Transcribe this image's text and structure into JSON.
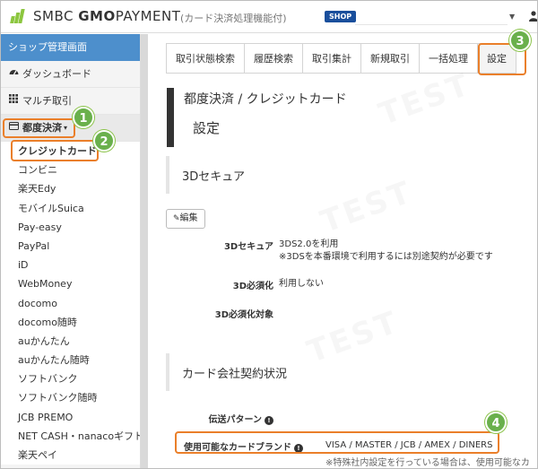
{
  "header": {
    "brand_prefix": "SMBC",
    "brand_bold": "GMO",
    "brand_suffix": "PAYMENT",
    "subtitle": "(カード決済処理機能付)",
    "shop_badge": "SHOP",
    "shop_value": "",
    "icons": {
      "user": "user-icon",
      "caret": "chevron-down-icon"
    }
  },
  "sidebar": {
    "heading": "ショップ管理画面",
    "items": [
      {
        "label": "ダッシュボード",
        "icon": "dashboard-icon"
      },
      {
        "label": "マルチ取引",
        "icon": "grid-icon"
      },
      {
        "label": "都度決済",
        "icon": "card-icon",
        "caret": "▾"
      }
    ],
    "sub_items": [
      "クレジットカード",
      "コンビニ",
      "楽天Edy",
      "モバイルSuica",
      "Pay-easy",
      "PayPal",
      "iD",
      "WebMoney",
      "docomo",
      "docomo随時",
      "auかんたん",
      "auかんたん随時",
      "ソフトバンク",
      "ソフトバンク随時",
      "JCB PREMO",
      "NET CASH・nanacoギフト",
      "楽天ペイ"
    ]
  },
  "tabs": [
    "取引状態検索",
    "履歴検索",
    "取引集計",
    "新規取引",
    "一括処理",
    "設定"
  ],
  "main": {
    "breadcrumb": "都度決済 / クレジットカード",
    "page_title": "設定",
    "secure_section": {
      "title": "3Dセキュア",
      "edit_label": "編集",
      "rows": [
        {
          "label": "3Dセキュア",
          "value": "3DS2.0を利用",
          "note": "※3DSを本番環境で利用するには別途契約が必要です"
        },
        {
          "label": "3D必須化",
          "value": "利用しない"
        },
        {
          "label": "3D必須化対象",
          "value": ""
        }
      ]
    },
    "contract_section": {
      "title": "カード会社契約状況",
      "rows": [
        {
          "label": "伝送パターン",
          "value": ""
        },
        {
          "label": "使用可能なカードブランド",
          "value": "VISA / MASTER / JCB / AMEX / DINERS"
        }
      ],
      "note": "※特殊社内設定を行っている場合は、使用可能なカ"
    }
  },
  "annotations": [
    "1",
    "2",
    "3",
    "4"
  ],
  "watermark": "TEST",
  "colors": {
    "accent": "#4d8fcc",
    "highlight": "#ea7f2a",
    "badge": "#6ab04c",
    "shop": "#1a4f9c"
  }
}
